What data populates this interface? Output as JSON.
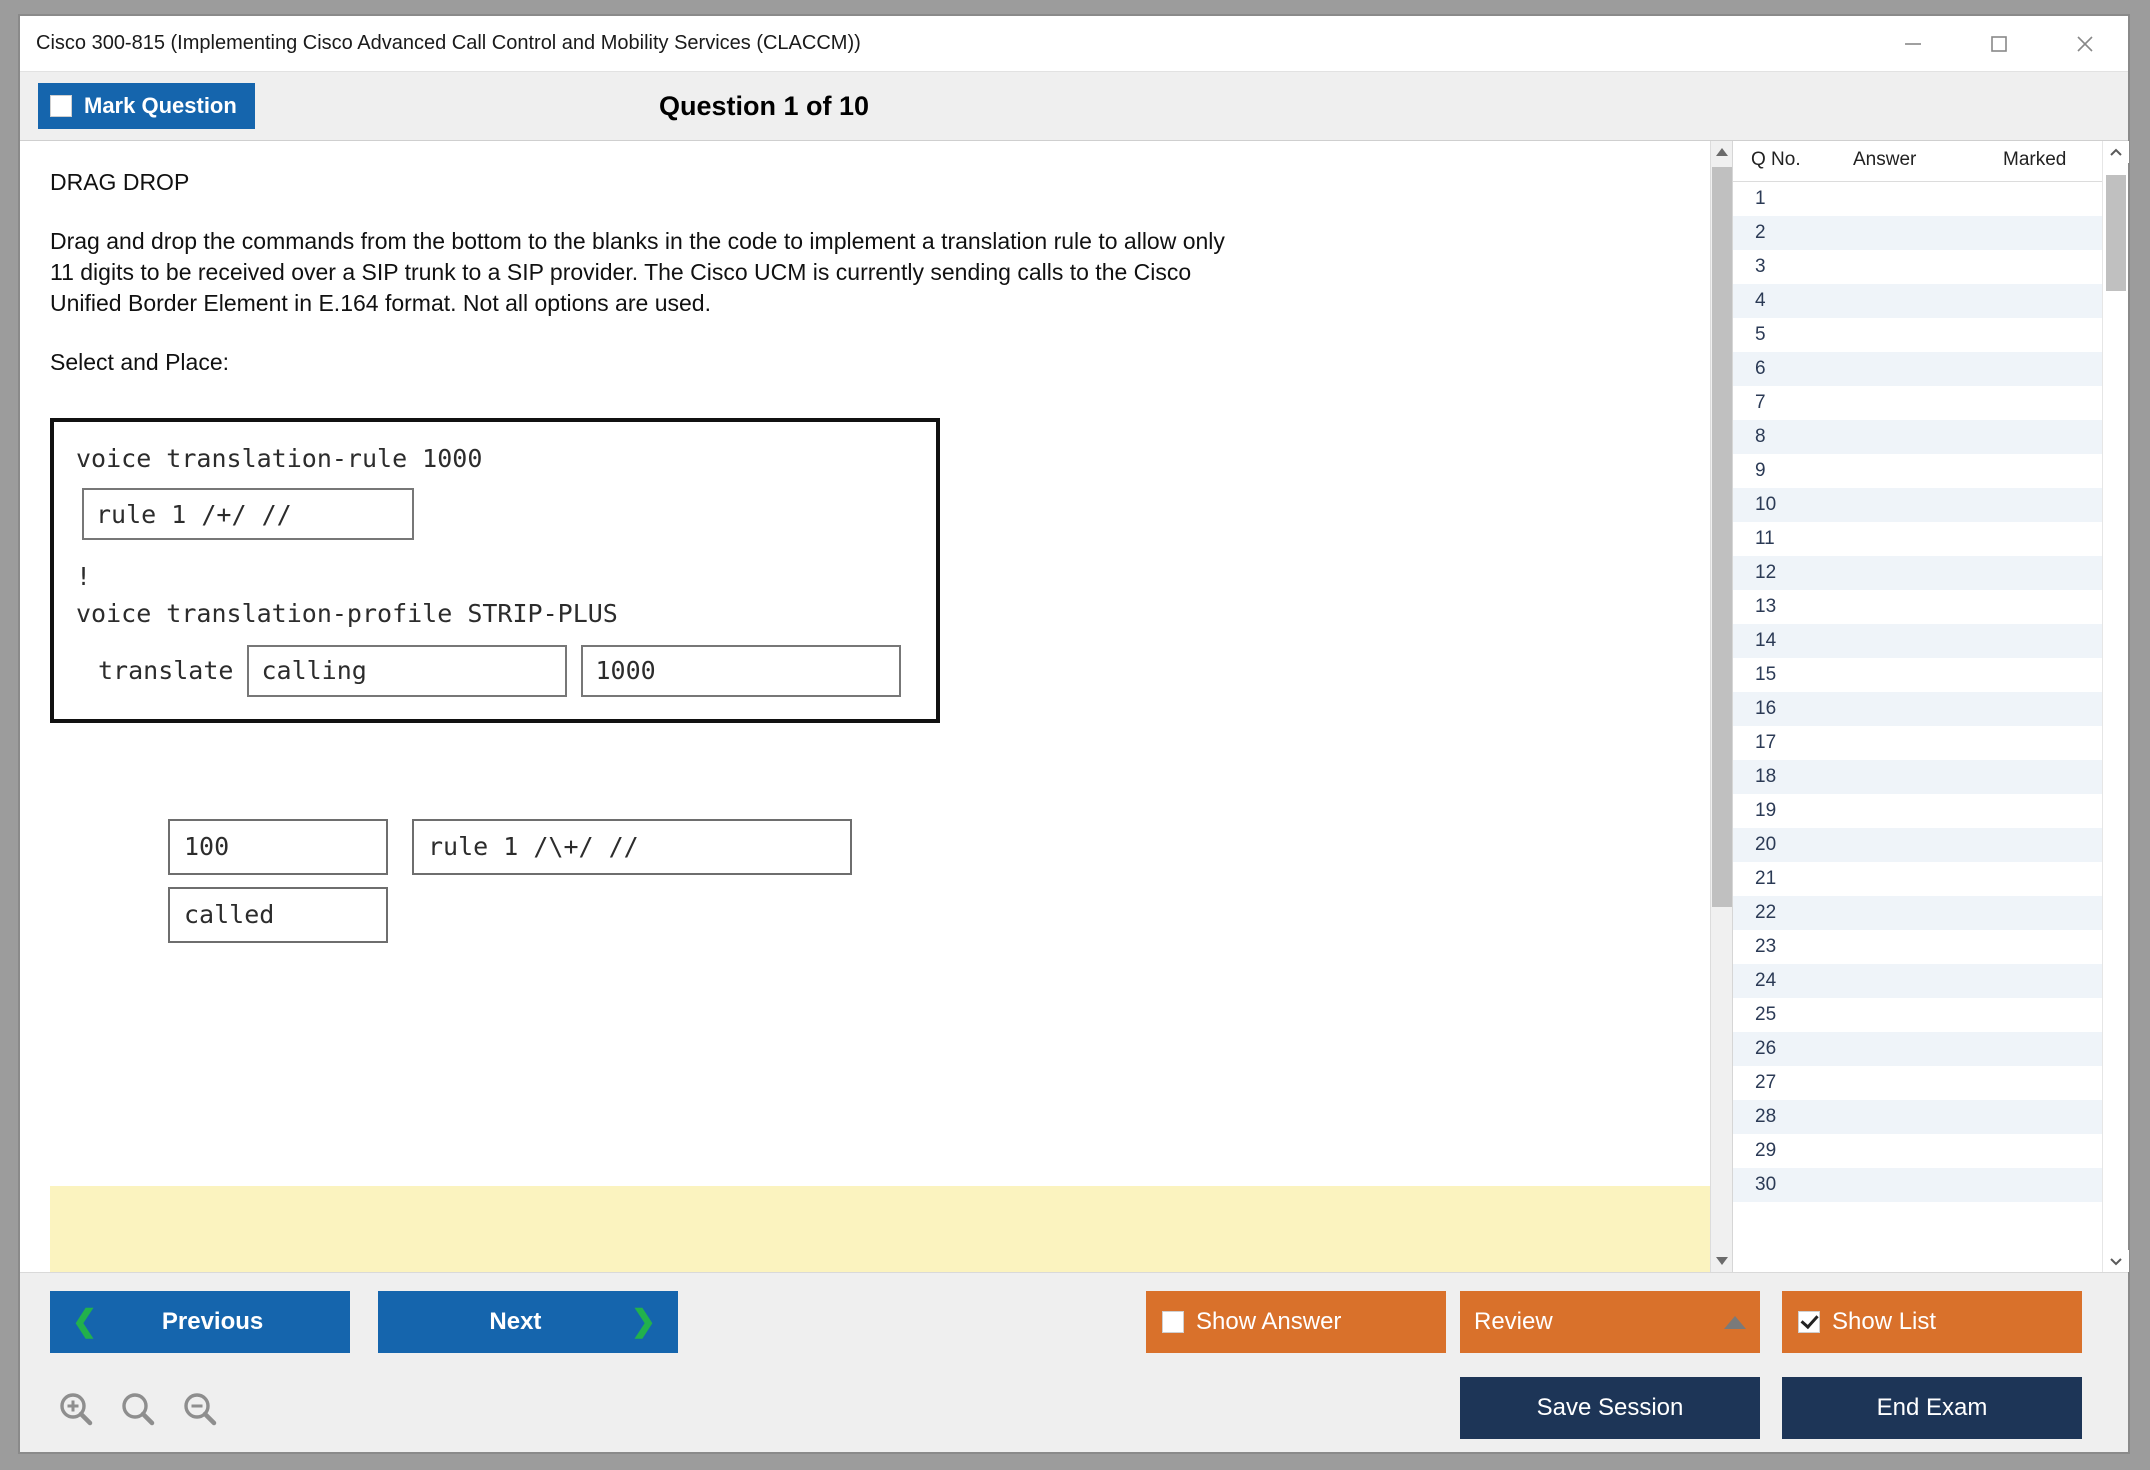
{
  "window": {
    "title": "Cisco 300-815 (Implementing Cisco Advanced Call Control and Mobility Services (CLACCM))",
    "controls": {
      "minimize": "minimize-icon",
      "maximize": "maximize-icon",
      "close": "close-icon"
    }
  },
  "toolbar": {
    "mark_question_label": "Mark Question",
    "mark_question_checked": false,
    "question_counter": "Question 1 of 10"
  },
  "question": {
    "type": "DRAG DROP",
    "prompt": "Drag and drop the commands from the bottom to the blanks in the code to implement a translation rule to allow only 11 digits to be received over a SIP trunk to a SIP provider. The Cisco UCM is currently sending calls to the Cisco Unified Border Element in E.164 format. Not all options are used.",
    "subtitle": "Select and Place:",
    "code": {
      "line1": "voice translation-rule 1000",
      "slot_rule": "rule 1 /+/ //",
      "line_bang": "!",
      "line2": "voice translation-profile STRIP-PLUS",
      "translate_label": "translate",
      "slot_calling": "calling",
      "slot_1000": "1000"
    },
    "options": [
      {
        "label": "100"
      },
      {
        "label": "rule 1 /\\+/ //"
      },
      {
        "label": "called"
      }
    ]
  },
  "list_panel": {
    "columns": [
      "Q No.",
      "Answer",
      "Marked"
    ],
    "rows": [
      {
        "qno": "1",
        "answer": "",
        "marked": ""
      },
      {
        "qno": "2",
        "answer": "",
        "marked": ""
      },
      {
        "qno": "3",
        "answer": "",
        "marked": ""
      },
      {
        "qno": "4",
        "answer": "",
        "marked": ""
      },
      {
        "qno": "5",
        "answer": "",
        "marked": ""
      },
      {
        "qno": "6",
        "answer": "",
        "marked": ""
      },
      {
        "qno": "7",
        "answer": "",
        "marked": ""
      },
      {
        "qno": "8",
        "answer": "",
        "marked": ""
      },
      {
        "qno": "9",
        "answer": "",
        "marked": ""
      },
      {
        "qno": "10",
        "answer": "",
        "marked": ""
      },
      {
        "qno": "11",
        "answer": "",
        "marked": ""
      },
      {
        "qno": "12",
        "answer": "",
        "marked": ""
      },
      {
        "qno": "13",
        "answer": "",
        "marked": ""
      },
      {
        "qno": "14",
        "answer": "",
        "marked": ""
      },
      {
        "qno": "15",
        "answer": "",
        "marked": ""
      },
      {
        "qno": "16",
        "answer": "",
        "marked": ""
      },
      {
        "qno": "17",
        "answer": "",
        "marked": ""
      },
      {
        "qno": "18",
        "answer": "",
        "marked": ""
      },
      {
        "qno": "19",
        "answer": "",
        "marked": ""
      },
      {
        "qno": "20",
        "answer": "",
        "marked": ""
      },
      {
        "qno": "21",
        "answer": "",
        "marked": ""
      },
      {
        "qno": "22",
        "answer": "",
        "marked": ""
      },
      {
        "qno": "23",
        "answer": "",
        "marked": ""
      },
      {
        "qno": "24",
        "answer": "",
        "marked": ""
      },
      {
        "qno": "25",
        "answer": "",
        "marked": ""
      },
      {
        "qno": "26",
        "answer": "",
        "marked": ""
      },
      {
        "qno": "27",
        "answer": "",
        "marked": ""
      },
      {
        "qno": "28",
        "answer": "",
        "marked": ""
      },
      {
        "qno": "29",
        "answer": "",
        "marked": ""
      },
      {
        "qno": "30",
        "answer": "",
        "marked": ""
      }
    ]
  },
  "footer": {
    "previous_label": "Previous",
    "next_label": "Next",
    "show_answer_label": "Show Answer",
    "show_answer_checked": false,
    "review_label": "Review",
    "show_list_label": "Show List",
    "show_list_checked": true,
    "save_session_label": "Save Session",
    "end_exam_label": "End Exam",
    "zoom_tools": [
      "zoom-in-icon",
      "zoom-reset-icon",
      "zoom-out-icon"
    ]
  },
  "colors": {
    "primary_blue": "#1565ad",
    "orange": "#d9712b",
    "navy": "#1d3557",
    "green_chevron": "#22b14c",
    "yellow_banner": "#fbf3bf",
    "row_alt": "#eff4f9"
  }
}
